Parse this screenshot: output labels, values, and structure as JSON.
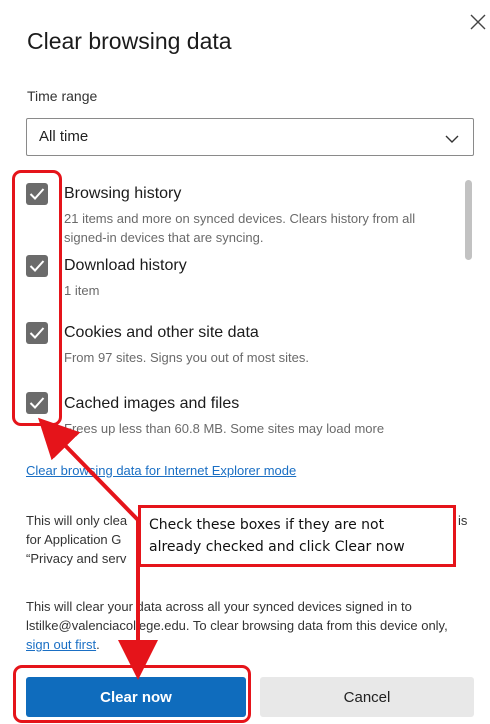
{
  "dialog": {
    "title": "Clear browsing data",
    "close_icon": "close-icon"
  },
  "time_range": {
    "label": "Time range",
    "selected": "All time",
    "chevron_icon": "chevron-down-icon"
  },
  "items": [
    {
      "title": "Browsing history",
      "desc": "21 items and more on synced devices. Clears history from all signed-in devices that are syncing.",
      "checked": true
    },
    {
      "title": "Download history",
      "desc": "1 item",
      "checked": true
    },
    {
      "title": "Cookies and other site data",
      "desc": "From 97 sites. Signs you out of most sites.",
      "checked": true
    },
    {
      "title": "Cached images and files",
      "desc": "Frees up less than 60.8 MB. Some sites may load more",
      "checked": true
    }
  ],
  "ie_link": "Clear browsing data for Internet Explorer mode",
  "info1": {
    "line1a": "This will only clea",
    "line1b": "is",
    "line2a": "for Application G",
    "line3a": "“Privacy and serv"
  },
  "info2": {
    "text_before": "This will clear your data across all your synced devices signed in to lstilke@valenciacollege.edu. To clear browsing data from this device only, ",
    "link": "sign out first",
    "text_after": "."
  },
  "buttons": {
    "clear": "Clear now",
    "cancel": "Cancel"
  },
  "callout": {
    "line1": "Check these boxes if they are not",
    "line2": "already checked and click Clear now"
  },
  "colors": {
    "accent": "#0f6cbd",
    "annotation": "#e5141a",
    "checkbox": "#6b6b6b",
    "link": "#1a6fc4"
  }
}
